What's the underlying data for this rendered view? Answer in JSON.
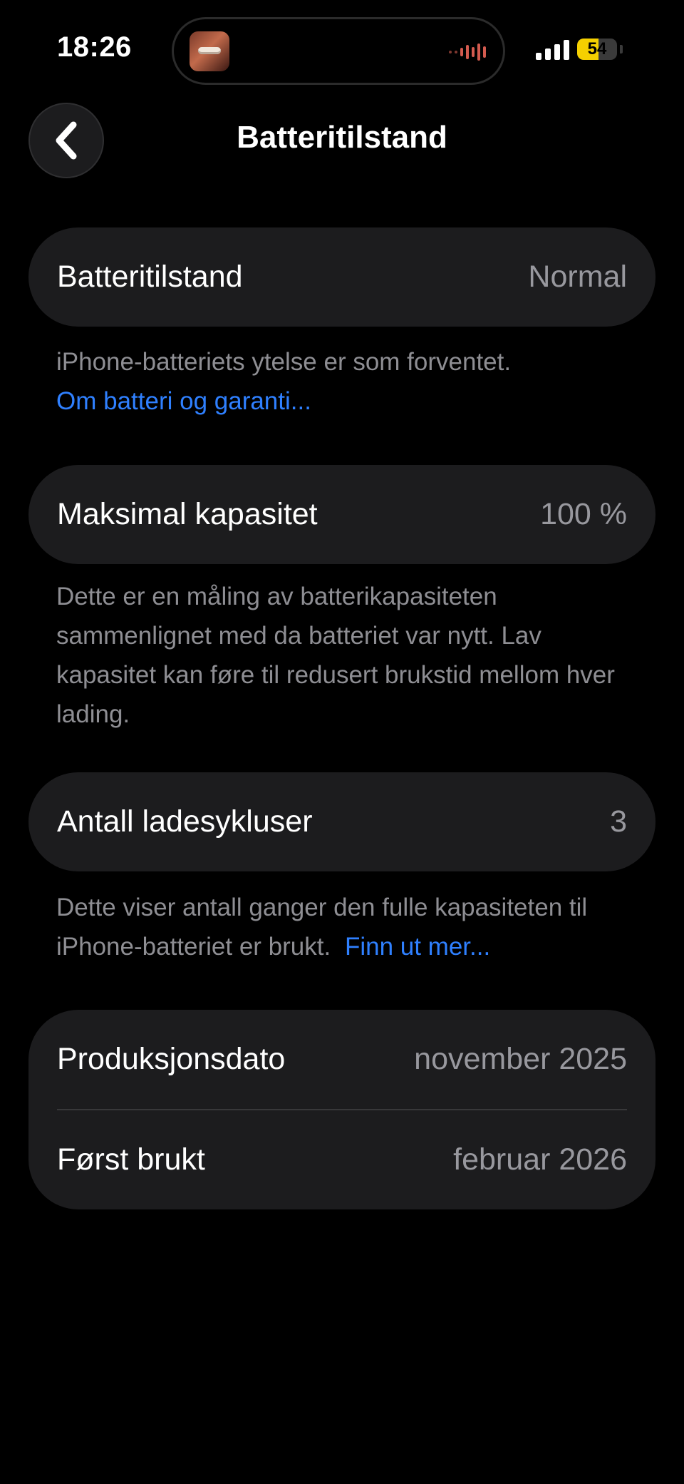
{
  "status_bar": {
    "time": "18:26",
    "battery_level": "54",
    "battery_fraction": 0.54,
    "signal_bars": 4,
    "island_activity": "audio-playing-thumbnail"
  },
  "colors": {
    "background": "#000000",
    "card": "#1c1c1e",
    "link": "#2f80ff",
    "secondary_text": "#8e8e93",
    "battery_yellow": "#f5d000"
  },
  "nav": {
    "back_icon": "chevron-left-icon",
    "title": "Batteritilstand"
  },
  "battery_health": {
    "label": "Batteritilstand",
    "value": "Normal",
    "footer_text": "iPhone-batteriets ytelse er som forventet.",
    "footer_link": "Om batteri og garanti..."
  },
  "max_capacity": {
    "label": "Maksimal kapasitet",
    "value": "100 %",
    "footer_text": "Dette er en måling av batterikapasiteten sammenlignet med da batteriet var nytt. Lav kapasitet kan føre til redusert brukstid mellom hver lading."
  },
  "cycle_count": {
    "label": "Antall ladesykluser",
    "value": "3",
    "footer_text": "Dette viser antall ganger den fulle kapasiteten til iPhone-batteriet er brukt.",
    "footer_link": "Finn ut mer..."
  },
  "dates": {
    "manufacture_label": "Produksjonsdato",
    "manufacture_value": "november 2025",
    "first_use_label": "Først brukt",
    "first_use_value": "februar 2026"
  }
}
